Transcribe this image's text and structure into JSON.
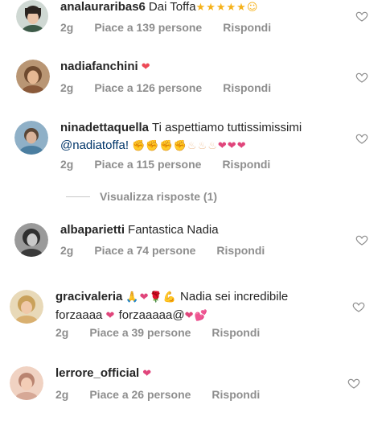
{
  "comments": [
    {
      "username": "analauraribas6",
      "text": "Dai Toffa",
      "emoji": "★★★★★☺",
      "age": "2g",
      "likes": "Piace a 139 persone",
      "reply": "Rispondi"
    },
    {
      "username": "nadiafanchini",
      "text": "",
      "emoji": "❤",
      "age": "2g",
      "likes": "Piace a 126 persone",
      "reply": "Rispondi"
    },
    {
      "username": "ninadettaquella",
      "text": "Ti aspettiamo tuttissimissimi",
      "mention": "@nadiatoffa!",
      "emoji": "✊✊✊✊♨♨♨",
      "emoji_hearts": "❤❤❤",
      "age": "2g",
      "likes": "Piace a 115 persone",
      "reply": "Rispondi"
    },
    {
      "username": "albaparietti",
      "text": "Fantastica Nadia",
      "age": "2g",
      "likes": "Piace a 74 persone",
      "reply": "Rispondi"
    },
    {
      "username": "gracivaleria",
      "emoji_pre": "🙏❤🌹💪",
      "text": "Nadia sei incredibile",
      "text2": "forzaaaa",
      "text3": "forzaaaaa@",
      "emoji2": "❤",
      "emoji3": "❤💕",
      "age": "2g",
      "likes": "Piace a 39 persone",
      "reply": "Rispondi"
    },
    {
      "username": "lerrore_official",
      "text": "",
      "emoji": "❤",
      "age": "2g",
      "likes": "Piace a 26 persone",
      "reply": "Rispondi"
    }
  ],
  "view_replies": "Visualizza risposte (1)",
  "icons": {
    "like": "heart-outline-icon",
    "avatar": "avatar"
  },
  "colors": {
    "username": "#262626",
    "meta": "#8e8e8e",
    "red_heart": "#ed4956",
    "pink_heart": "#e0457b",
    "heart_outline": "#8e8e8e"
  }
}
